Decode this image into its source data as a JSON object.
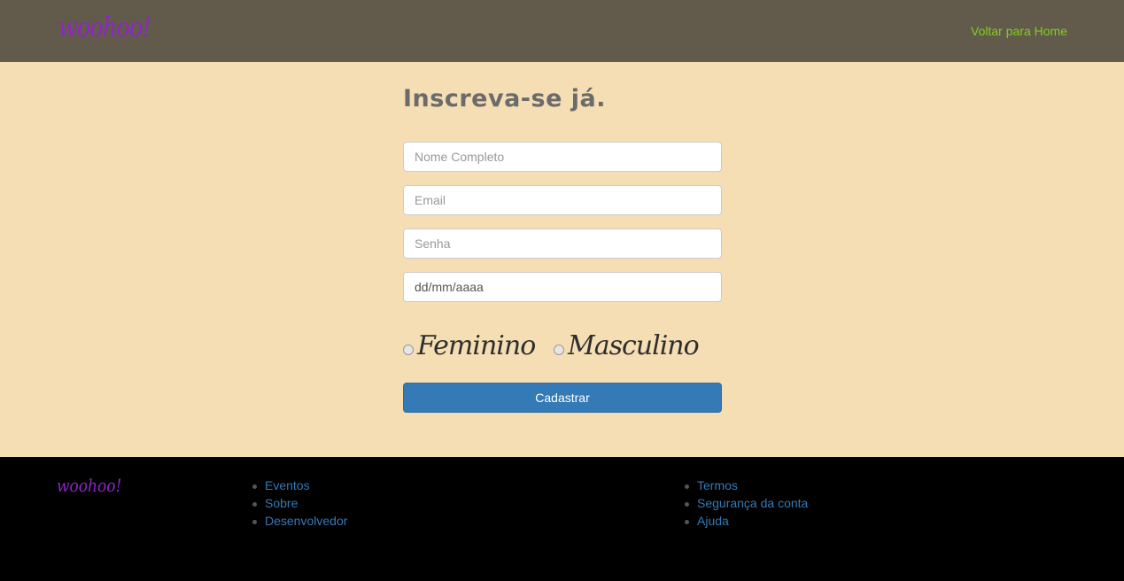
{
  "navbar": {
    "logo": "woohoo!",
    "home_link": "Voltar para Home"
  },
  "form": {
    "title": "Inscreva-se já.",
    "name_placeholder": "Nome Completo",
    "email_placeholder": "Email",
    "password_placeholder": "Senha",
    "date_value": "dd/mm/aaaa",
    "gender_options": [
      "Feminino",
      "Masculino"
    ],
    "submit_label": "Cadastrar"
  },
  "footer": {
    "logo": "woohoo!",
    "links_left": [
      "Eventos",
      "Sobre",
      "Desenvolvedor"
    ],
    "links_right": [
      "Termos",
      "Segurança da conta",
      "Ajuda"
    ]
  },
  "colors": {
    "navbar_bg": "#625b4b",
    "page_bg": "#f5deb3",
    "logo": "#8e24c9",
    "nav_link": "#7fcf1c",
    "button": "#337ab7",
    "footer_bg": "#000000"
  }
}
